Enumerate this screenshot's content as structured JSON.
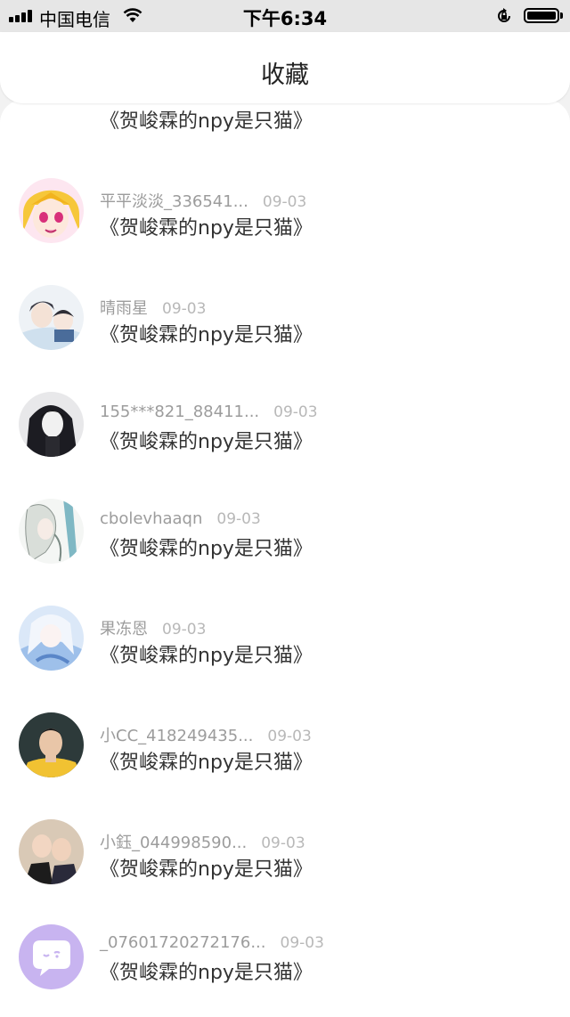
{
  "status_bar": {
    "carrier": "中国电信",
    "time": "下午6:34"
  },
  "header": {
    "title": "收藏"
  },
  "items": [
    {
      "name": "",
      "date": "",
      "book": "《贺峻霖的npy是只猫》"
    },
    {
      "name": "平平淡淡_336541...",
      "date": "09-03",
      "book": "《贺峻霖的npy是只猫》"
    },
    {
      "name": "晴雨星",
      "date": "09-03",
      "book": "《贺峻霖的npy是只猫》"
    },
    {
      "name": "155***821_88411...",
      "date": "09-03",
      "book": "《贺峻霖的npy是只猫》"
    },
    {
      "name": "cbolevhaaqn",
      "date": "09-03",
      "book": "《贺峻霖的npy是只猫》"
    },
    {
      "name": "果冻恩",
      "date": "09-03",
      "book": "《贺峻霖的npy是只猫》"
    },
    {
      "name": "小CC_418249435...",
      "date": "09-03",
      "book": "《贺峻霖的npy是只猫》"
    },
    {
      "name": "小鈺_044998590...",
      "date": "09-03",
      "book": "《贺峻霖的npy是只猫》"
    },
    {
      "name": "_07601720272176...",
      "date": "09-03",
      "book": "《贺峻霖的npy是只猫》"
    }
  ],
  "colors": {
    "accent": "#c8b4f0",
    "name_gray": "#9c9c9c",
    "date_gray": "#b8b8b8"
  }
}
